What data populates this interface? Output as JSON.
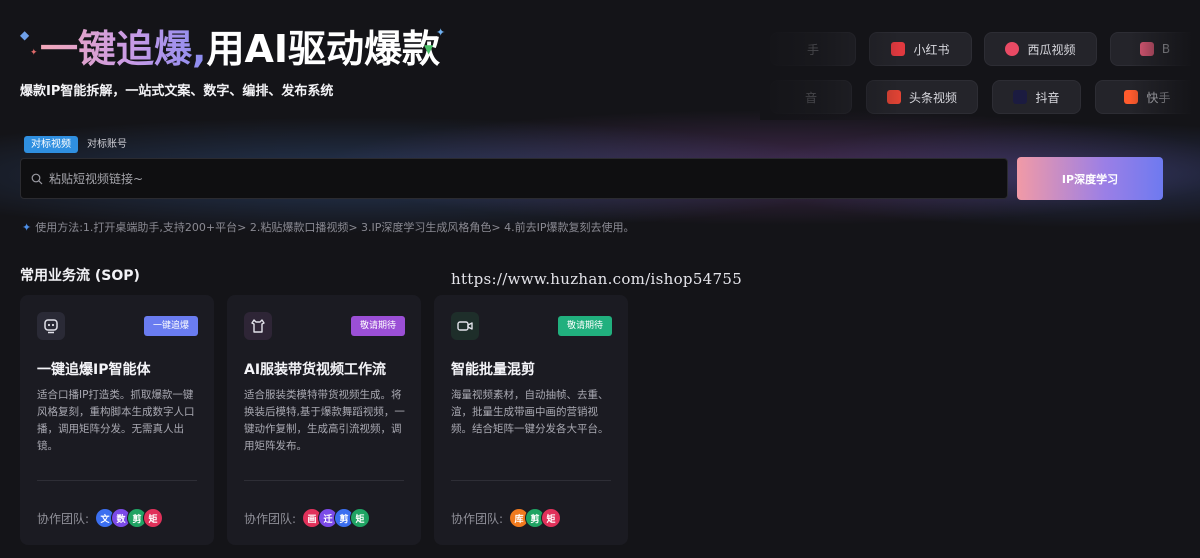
{
  "hero": {
    "title_grad": "一键追爆,",
    "title_white": "用AI驱动爆款",
    "subtitle": "爆款IP智能拆解，一站式文案、数字、编排、发布系统"
  },
  "platforms": [
    {
      "label": "手",
      "color": "#666"
    },
    {
      "label": "小红书",
      "color": "#e0393f"
    },
    {
      "label": "西瓜视频",
      "color": "#e94a64"
    },
    {
      "label": "B",
      "color": "#e85c7a"
    },
    {
      "label": "音",
      "color": "#555"
    },
    {
      "label": "头条视频",
      "color": "#e14334"
    },
    {
      "label": "抖音",
      "color": "#1b1b40"
    },
    {
      "label": "快手",
      "color": "#ff5b2d"
    }
  ],
  "tabs": [
    "对标视频",
    "对标账号"
  ],
  "search": {
    "placeholder": "粘贴短视频链接~"
  },
  "learn_button": "IP深度学习",
  "usage": "使用方法:1.打开桌端助手,支持200+平台> 2.粘贴爆款口播视频> 3.IP深度学习生成风格角色> 4.前去IP爆款复刻去使用。",
  "section_title": "常用业务流 (SOP)",
  "watermark": "https://www.huzhan.com/ishop54755",
  "cards": [
    {
      "title": "一键追爆IP智能体",
      "badge": "一键追爆",
      "badge_color": "#6a7cf0",
      "desc": "适合口播IP打造类。抓取爆款一键风格复刻，重构脚本生成数字人口播，调用矩阵分发。无需真人出镜。",
      "team_label": "协作团队:",
      "team": [
        {
          "t": "文",
          "c": "#3b6ff0"
        },
        {
          "t": "数",
          "c": "#7b4ae8"
        },
        {
          "t": "剪",
          "c": "#1fa363"
        },
        {
          "t": "矩",
          "c": "#e0315a"
        }
      ]
    },
    {
      "title": "AI服装带货视频工作流",
      "badge": "敬请期待",
      "badge_color": "#9b4fd6",
      "desc": "适合服装类模特带货视频生成。将换装后模特,基于爆款舞蹈视频，一键动作复制，生成高引流视频，调用矩阵发布。",
      "team_label": "协作团队:",
      "team": [
        {
          "t": "画",
          "c": "#e0315a"
        },
        {
          "t": "迁",
          "c": "#7b4ae8"
        },
        {
          "t": "剪",
          "c": "#3b6ff0"
        },
        {
          "t": "矩",
          "c": "#1fa363"
        }
      ]
    },
    {
      "title": "智能批量混剪",
      "badge": "敬请期待",
      "badge_color": "#21b07e",
      "desc": "海量视频素材，自动抽帧、去重、渲，批量生成带画中画的营销视频。结合矩阵一键分发各大平台。",
      "team_label": "协作团队:",
      "team": [
        {
          "t": "库",
          "c": "#f07a1e"
        },
        {
          "t": "剪",
          "c": "#1fa363"
        },
        {
          "t": "矩",
          "c": "#e0315a"
        }
      ]
    }
  ]
}
